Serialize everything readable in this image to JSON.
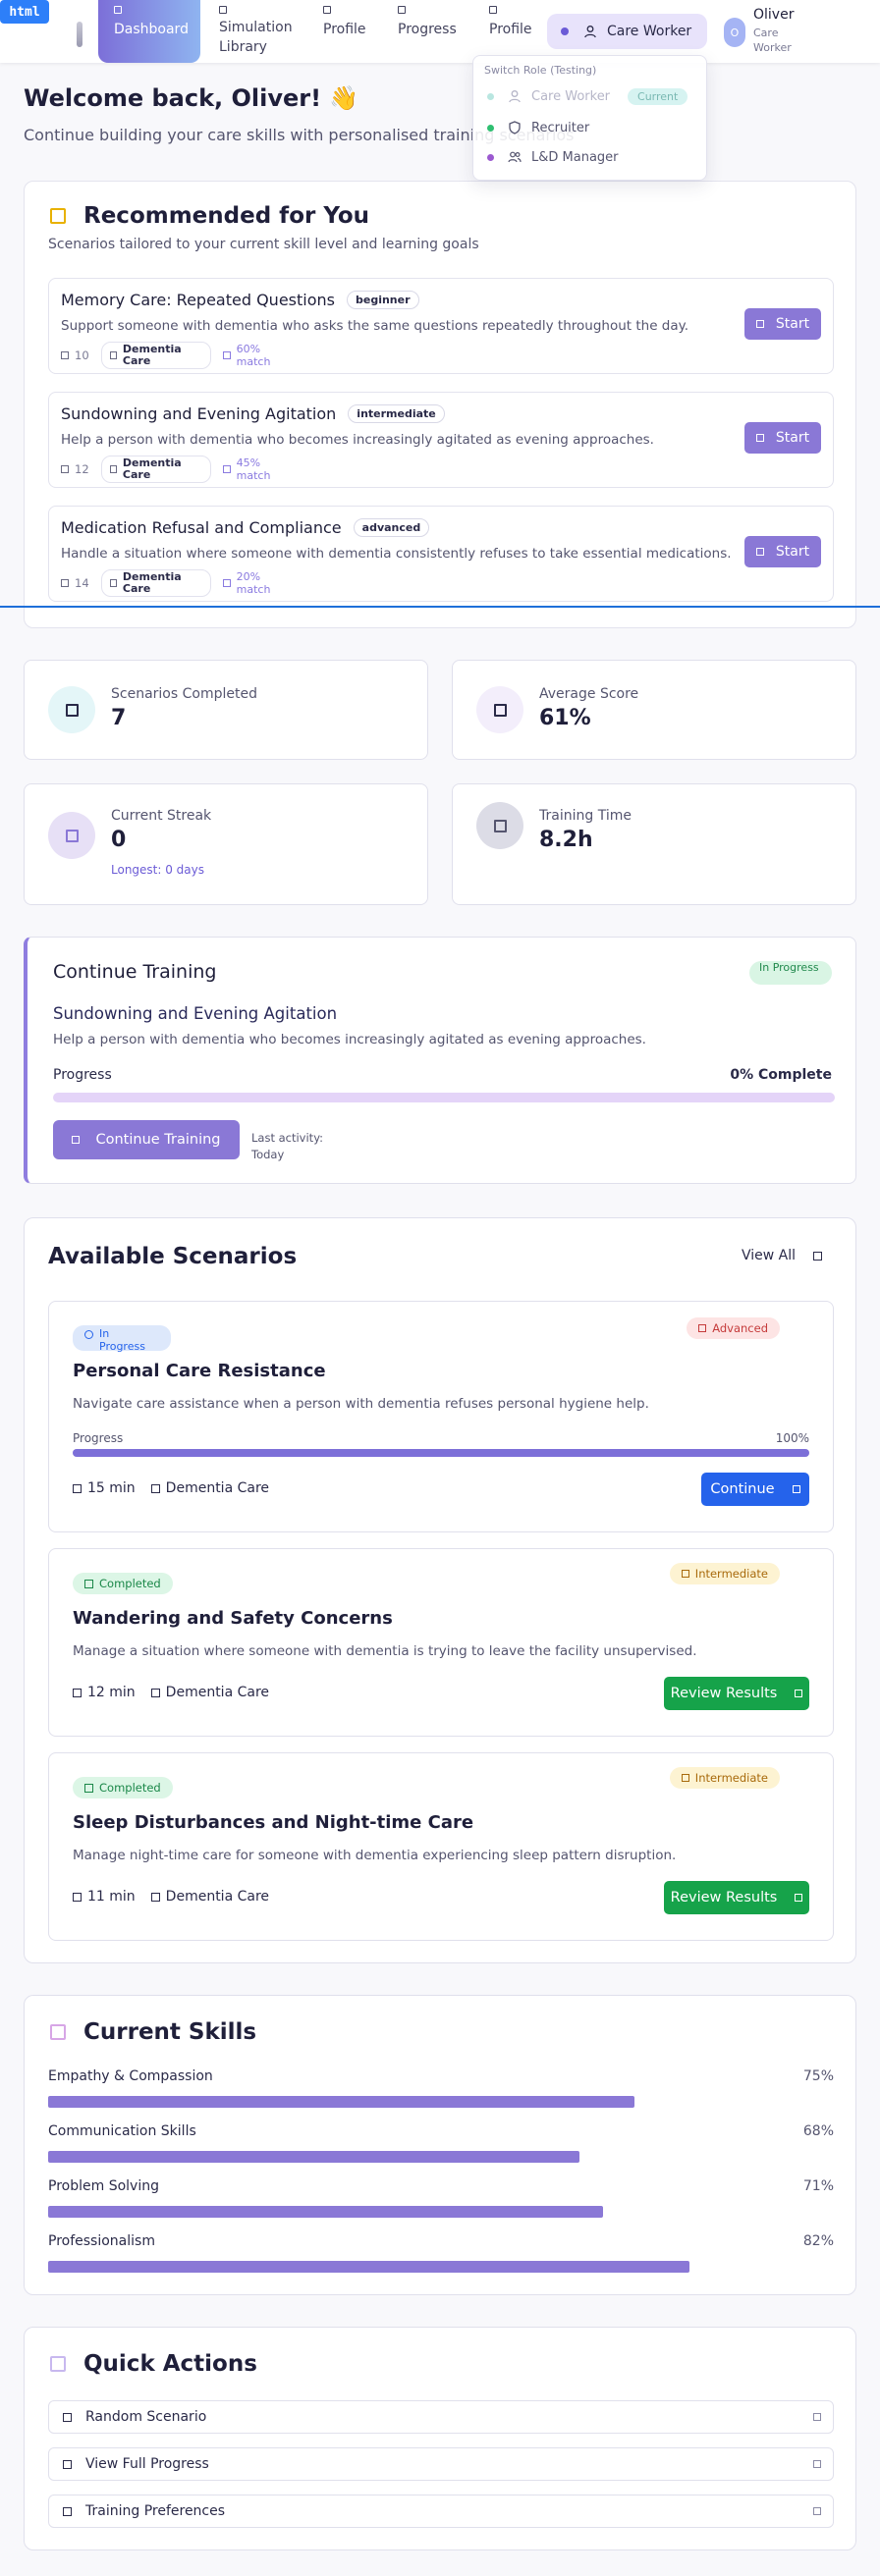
{
  "nav": {
    "items": [
      {
        "label": "Dashboard"
      },
      {
        "label": "Simulation Library"
      },
      {
        "label": "Profile"
      },
      {
        "label": "Progress"
      },
      {
        "label": "Profile"
      }
    ],
    "role_button": "Care Worker",
    "user": {
      "initial": "O",
      "name": "Oliver",
      "role": "Care Worker"
    }
  },
  "role_menu": {
    "heading": "Switch Role (Testing)",
    "options": [
      {
        "label": "Care Worker",
        "badge": "Current",
        "color": "#7fd3c8"
      },
      {
        "label": "Recruiter",
        "color": "#2fbf71"
      },
      {
        "label": "L&D Manager",
        "color": "#9b59d0"
      }
    ]
  },
  "welcome": {
    "title": "Welcome back, Oliver! 👋",
    "subtitle": "Continue building your care skills with personalised training scenarios"
  },
  "recommended": {
    "title": "Recommended for You",
    "subtitle": "Scenarios tailored to your current skill level and learning goals",
    "items": [
      {
        "title": "Memory Care: Repeated Questions",
        "level": "beginner",
        "description": "Support someone with dementia who asks the same questions repeatedly throughout the day.",
        "count": "10",
        "tag": "Dementia Care",
        "match": "60% match",
        "button": "Start"
      },
      {
        "title": "Sundowning and Evening Agitation",
        "level": "intermediate",
        "description": "Help a person with dementia who becomes increasingly agitated as evening approaches.",
        "count": "12",
        "tag": "Dementia Care",
        "match": "45% match",
        "button": "Start"
      },
      {
        "title": "Medication Refusal and Compliance",
        "level": "advanced",
        "description": "Handle a situation where someone with dementia consistently refuses to take essential medications.",
        "count": "14",
        "tag": "Dementia Care",
        "match": "20% match",
        "button": "Start"
      }
    ]
  },
  "stats": {
    "completed": {
      "label": "Scenarios Completed",
      "value": "7"
    },
    "average": {
      "label": "Average Score",
      "value": "61%"
    },
    "streak": {
      "label": "Current Streak",
      "value": "0",
      "extra": "Longest: 0 days"
    },
    "time": {
      "label": "Training Time",
      "value": "8.2h"
    }
  },
  "continue_training": {
    "title": "Continue Training",
    "status": "In Progress",
    "scenario": "Sundowning and Evening Agitation",
    "description": "Help a person with dementia who becomes increasingly agitated as evening approaches.",
    "progress_label": "Progress",
    "progress_text": "0% Complete",
    "progress": 0,
    "button": "Continue Training",
    "last_activity": "Last activity: Today"
  },
  "available": {
    "title": "Available Scenarios",
    "view_all": "View All",
    "items": [
      {
        "status": "In Progress",
        "difficulty": "Advanced",
        "title": "Personal Care Resistance",
        "description": "Navigate care assistance when a person with dementia refuses personal hygiene help.",
        "progress_label": "Progress",
        "progress_text": "100%",
        "progress": 1.0,
        "duration": "15 min",
        "category": "Dementia Care",
        "button": "Continue"
      },
      {
        "status": "Completed",
        "difficulty": "Intermediate",
        "title": "Wandering and Safety Concerns",
        "description": "Manage a situation where someone with dementia is trying to leave the facility unsupervised.",
        "duration": "12 min",
        "category": "Dementia Care",
        "button": "Review Results"
      },
      {
        "status": "Completed",
        "difficulty": "Intermediate",
        "title": "Sleep Disturbances and Night-time Care",
        "description": "Manage night-time care for someone with dementia experiencing sleep pattern disruption.",
        "duration": "11 min",
        "category": "Dementia Care",
        "button": "Review Results"
      }
    ]
  },
  "skills": {
    "title": "Current Skills",
    "items": [
      {
        "name": "Empathy & Compassion",
        "pct": "75%",
        "value": 0.75
      },
      {
        "name": "Communication Skills",
        "pct": "68%",
        "value": 0.68
      },
      {
        "name": "Problem Solving",
        "pct": "71%",
        "value": 0.71
      },
      {
        "name": "Professionalism",
        "pct": "82%",
        "value": 0.82
      }
    ]
  },
  "quick_actions": {
    "title": "Quick Actions",
    "items": [
      {
        "label": "Random Scenario"
      },
      {
        "label": "View Full Progress"
      },
      {
        "label": "Training Preferences"
      }
    ]
  },
  "colors": {
    "accent": "#8a78d6",
    "primary_blue": "#2563eb",
    "success_green": "#16a34a"
  }
}
